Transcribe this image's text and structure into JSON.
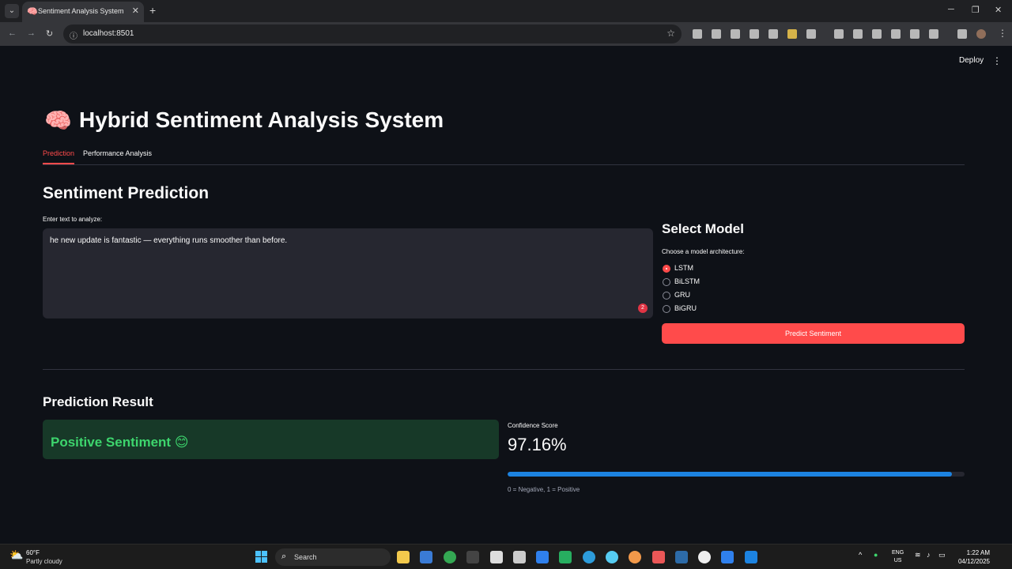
{
  "browser": {
    "tab_title": "Sentiment Analysis System",
    "tab_favicon": "🧠",
    "url": "localhost:8501"
  },
  "app": {
    "deploy_label": "Deploy",
    "title_emoji": "🧠",
    "title": "Hybrid Sentiment Analysis System",
    "tabs": [
      {
        "label": "Prediction",
        "active": true
      },
      {
        "label": "Performance Analysis",
        "active": false
      }
    ],
    "prediction": {
      "heading": "Sentiment Prediction",
      "input_label": "Enter text to analyze:",
      "input_value": "he new update is fantastic — everything runs smoother than before.",
      "grammar_count": "2"
    },
    "model": {
      "heading": "Select Model",
      "radio_label": "Choose a model architecture:",
      "options": [
        "LSTM",
        "BiLSTM",
        "GRU",
        "BiGRU"
      ],
      "selected": "LSTM"
    },
    "predict_button": "Predict Sentiment",
    "result": {
      "heading": "Prediction Result",
      "sentiment_text": "Positive Sentiment 😊",
      "confidence_label": "Confidence Score",
      "confidence_value": "97.16%",
      "confidence_fraction": 0.9716,
      "scale_caption": "0 = Negative, 1 = Positive"
    }
  },
  "taskbar": {
    "weather_temp": "60°F",
    "weather_desc": "Partly cloudy",
    "search_label": "Search",
    "lang_line1": "ENG",
    "lang_line2": "US",
    "time": "1:22 AM",
    "date": "04/12/2025"
  },
  "colors": {
    "accent": "#ff4b4b",
    "success_bg": "#173928",
    "success_text": "#3dd56d",
    "progress": "#1c83e1",
    "background": "#0e1117"
  }
}
